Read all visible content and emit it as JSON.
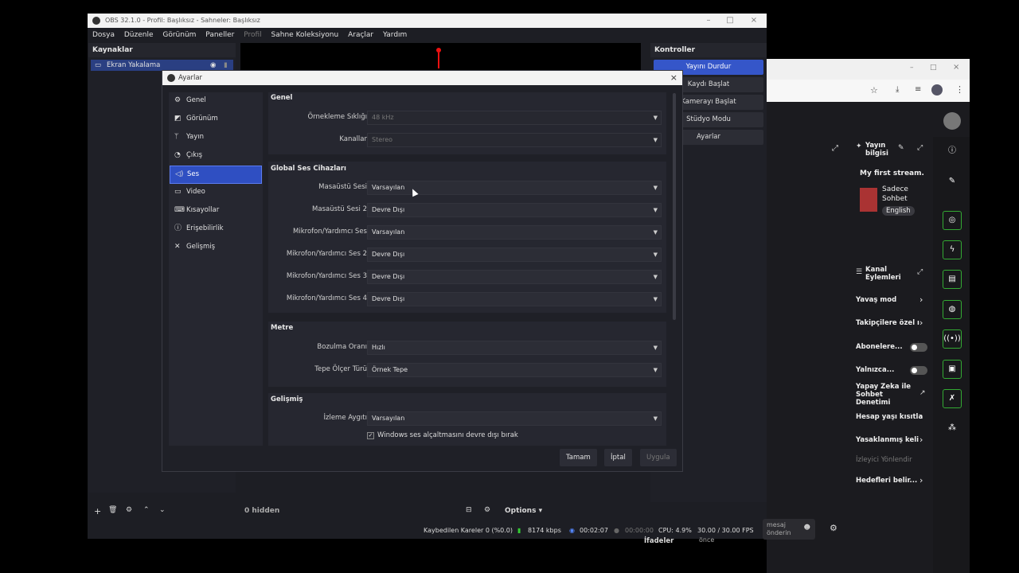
{
  "obs": {
    "title": "OBS 32.1.0 - Profil: Başlıksız - Sahneler: Başlıksız",
    "menu": [
      "Dosya",
      "Düzenle",
      "Görünüm",
      "Paneller",
      "Profil",
      "Sahne Koleksiyonu",
      "Araçlar",
      "Yardım"
    ],
    "sources_title": "Kaynaklar",
    "source_item": "Ekran Yakalama",
    "controls_title": "Kontroller",
    "controls": [
      "Yayını Durdur",
      "Kaydı Başlat",
      "Kamerayı Başlat",
      "Stüdyo Modu",
      "Ayarlar"
    ],
    "hidden_label": "0 hidden",
    "options_label": "Options",
    "status": {
      "dropped": "Kaybedilen Kareler 0 (%0.0)",
      "kbps": "8174 kbps",
      "stream_time": "00:02:07",
      "rec_time": "00:00:00",
      "cpu": "CPU: 4.9%",
      "fps": "30.00 / 30.00 FPS"
    }
  },
  "dialog": {
    "title": "Ayarlar",
    "nav": [
      {
        "label": "Genel",
        "icon": "gear-icon"
      },
      {
        "label": "Görünüm",
        "icon": "appearance-icon"
      },
      {
        "label": "Yayın",
        "icon": "antenna-icon"
      },
      {
        "label": "Çıkış",
        "icon": "output-icon"
      },
      {
        "label": "Ses",
        "icon": "speaker-icon"
      },
      {
        "label": "Video",
        "icon": "monitor-icon"
      },
      {
        "label": "Kısayollar",
        "icon": "keyboard-icon"
      },
      {
        "label": "Erişebilirlik",
        "icon": "accessibility-icon"
      },
      {
        "label": "Gelişmiş",
        "icon": "tools-icon"
      }
    ],
    "selected_nav": "Ses",
    "sections": {
      "general": "Genel",
      "devices": "Global Ses Cihazları",
      "meters": "Metre",
      "advanced": "Gelişmiş"
    },
    "fields": {
      "sample_rate": {
        "label": "Örnekleme Sıklığı",
        "value": "48 kHz"
      },
      "channels": {
        "label": "Kanallar",
        "value": "Stereo"
      },
      "desktop1": {
        "label": "Masaüstü Sesi",
        "value": "Varsayılan"
      },
      "desktop2": {
        "label": "Masaüstü Sesi 2",
        "value": "Devre Dışı"
      },
      "mic1": {
        "label": "Mikrofon/Yardımcı Ses",
        "value": "Varsayılan"
      },
      "mic2": {
        "label": "Mikrofon/Yardımcı Ses 2",
        "value": "Devre Dışı"
      },
      "mic3": {
        "label": "Mikrofon/Yardımcı Ses 3",
        "value": "Devre Dışı"
      },
      "mic4": {
        "label": "Mikrofon/Yardımcı Ses 4",
        "value": "Devre Dışı"
      },
      "decay": {
        "label": "Bozulma Oranı",
        "value": "Hızlı"
      },
      "peak": {
        "label": "Tepe Ölçer Türü",
        "value": "Örnek Tepe"
      },
      "monitor": {
        "label": "İzleme Aygıtı",
        "value": "Varsayılan"
      }
    },
    "checkbox_label": "Windows ses alçaltmasını devre dışı bırak",
    "buttons": {
      "ok": "Tamam",
      "cancel": "İptal",
      "apply": "Uygula"
    }
  },
  "twitch": {
    "stream_info_title": "Yayın bilgisi",
    "stream_title": "My first stream.",
    "category": "Sadece Sohbet",
    "language": "English",
    "channel_actions": "Kanal Eylemleri",
    "rows": [
      "Yavaş mod",
      "Takipçilere özel ı",
      "Abonelere...",
      "Yalnızca...",
      "Yapay Zeka ile Sohbet Denetimi",
      "Hesap yaşı kısıtla",
      "Yasaklanmış keli",
      "İzleyici Yönlendir",
      "Hedefleri belir..."
    ],
    "chat_placeholder": "mesaj önderin",
    "bottom_label": "İfadeler",
    "bottom_sub": "önce"
  },
  "colors": {
    "accent": "#3556c9",
    "panel": "#1f2027",
    "dialog_title": "#f3f3f3",
    "live_green": "#3a3"
  }
}
